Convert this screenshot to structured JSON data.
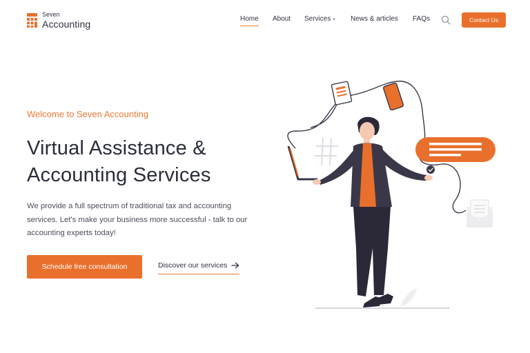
{
  "brand": {
    "name_small": "Seven",
    "name_big": "Accounting",
    "icon": "calculator-grid-icon",
    "accent_color": "#e9702c"
  },
  "nav": {
    "items": [
      {
        "label": "Home",
        "active": true
      },
      {
        "label": "About"
      },
      {
        "label": "Services",
        "has_dropdown": true
      },
      {
        "label": "News & articles"
      },
      {
        "label": "FAQs"
      }
    ],
    "search_icon": "search-icon",
    "contact_label": "Contact Us"
  },
  "hero": {
    "eyebrow": "Welcome to Seven Accounting",
    "title_line1": "Virtual Assistance &",
    "title_line2": "Accounting Services",
    "description": "We provide a full spectrum of traditional tax and accounting services. Let's make your business more successful - talk to our accounting experts today!",
    "primary_cta": "Schedule free consultation",
    "secondary_cta": "Discover our services",
    "secondary_icon": "arrow-right-icon"
  },
  "illustration": {
    "subject": "person-juggling-devices-illustration"
  }
}
